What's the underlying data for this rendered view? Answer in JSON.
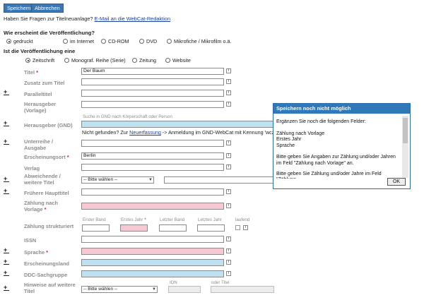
{
  "toolbar": {
    "save_label": "Speichern",
    "cancel_label": "Abbrechen"
  },
  "help": {
    "question": "Haben Sie Fragen zur Titelneuanlage?",
    "email_link": "E-Mail an die WebCat-Redaktion"
  },
  "publication_form": {
    "heading": "Wie erscheint die Veröffentlichung?",
    "options": [
      "gedruckt",
      "im Internet",
      "CD-ROM",
      "DVD",
      "Mikrofiche / Mikrofilm o.ä."
    ],
    "selected": "gedruckt"
  },
  "publication_type": {
    "heading": "Ist die Veröffentlichung eine",
    "options": [
      "Zeitschrift",
      "Monograf. Reihe (Serie)",
      "Zeitung",
      "Website"
    ],
    "selected": "Zeitschrift"
  },
  "fields": {
    "titel": {
      "label": "Titel",
      "value": "Der Baum"
    },
    "zusatz": {
      "label": "Zusatz zum Titel",
      "value": ""
    },
    "paralleltitel": {
      "label": "Paralleltitel",
      "value": ""
    },
    "herausgeber_vorlage": {
      "label": "Herausgeber (Vorlage)",
      "value": ""
    },
    "gnd_hint": "Suche in GND nach Körperschaft oder Person",
    "herausgeber_gnd": {
      "label": "Herausgeber (GND)",
      "value": ""
    },
    "gnd_not_found": "Nicht gefunden? Zur",
    "gnd_link": "Neuerfassung",
    "gnd_after": "-> Anmeldung im GND-WebCat mit Kennung 'wczdb'",
    "unterreihe": {
      "label": "Unterreihe / Ausgabe",
      "value": ""
    },
    "erscheinungsort": {
      "label": "Erscheinungsort",
      "value": "Berlin"
    },
    "verlag": {
      "label": "Verlag",
      "value": ""
    },
    "abweichende": {
      "label": "Abweichende / weitere Titel",
      "select": "-- Bitte wählen --"
    },
    "fruehere": {
      "label": "Frühere Haupttitel",
      "value": ""
    },
    "zaehlung_vorlage": {
      "label": "Zählung nach Vorlage",
      "value": ""
    },
    "zaehlung_strukturiert": {
      "label": "Zählung strukturiert",
      "col_erster_band": "Erster Band",
      "col_erstes_jahr": "Erstes Jahr",
      "col_letzter_band": "Letzter Band",
      "col_letztes_jahr": "Letztes Jahr",
      "col_laufend": "laufend"
    },
    "issn": {
      "label": "ISSN",
      "value": ""
    },
    "sprache": {
      "label": "Sprache",
      "value": ""
    },
    "erscheinungsland": {
      "label": "Erscheinungsland",
      "value": ""
    },
    "ddc": {
      "label": "DDC-Sachgruppe",
      "value": ""
    },
    "hinweise": {
      "label": "Hinweise auf weitere Titel",
      "select": "-- Bitte wählen --",
      "col_idn": "IDN",
      "col_oder_titel": "oder Titel"
    }
  },
  "dialog": {
    "title": "Speichern noch nicht möglich",
    "intro": "Ergänzen Sie noch die folgenden Felder:",
    "missing": [
      "Zählung nach Vorlage",
      "Erstes Jahr",
      "Sprache"
    ],
    "msg1": "Bitte geben Sie Angaben zur Zählung und/oder Jahren im Feld \"Zählung nach Vorlage\" an.",
    "msg2": "Bitte geben Sie Zählung und/oder Jahre im Feld \"Zählung",
    "ok_label": "OK"
  },
  "colors": {
    "accent": "#2f79b9",
    "required_bg": "#f8c8d2",
    "gnd_bg": "#bfe0ee",
    "required_marker": "#c62828"
  }
}
